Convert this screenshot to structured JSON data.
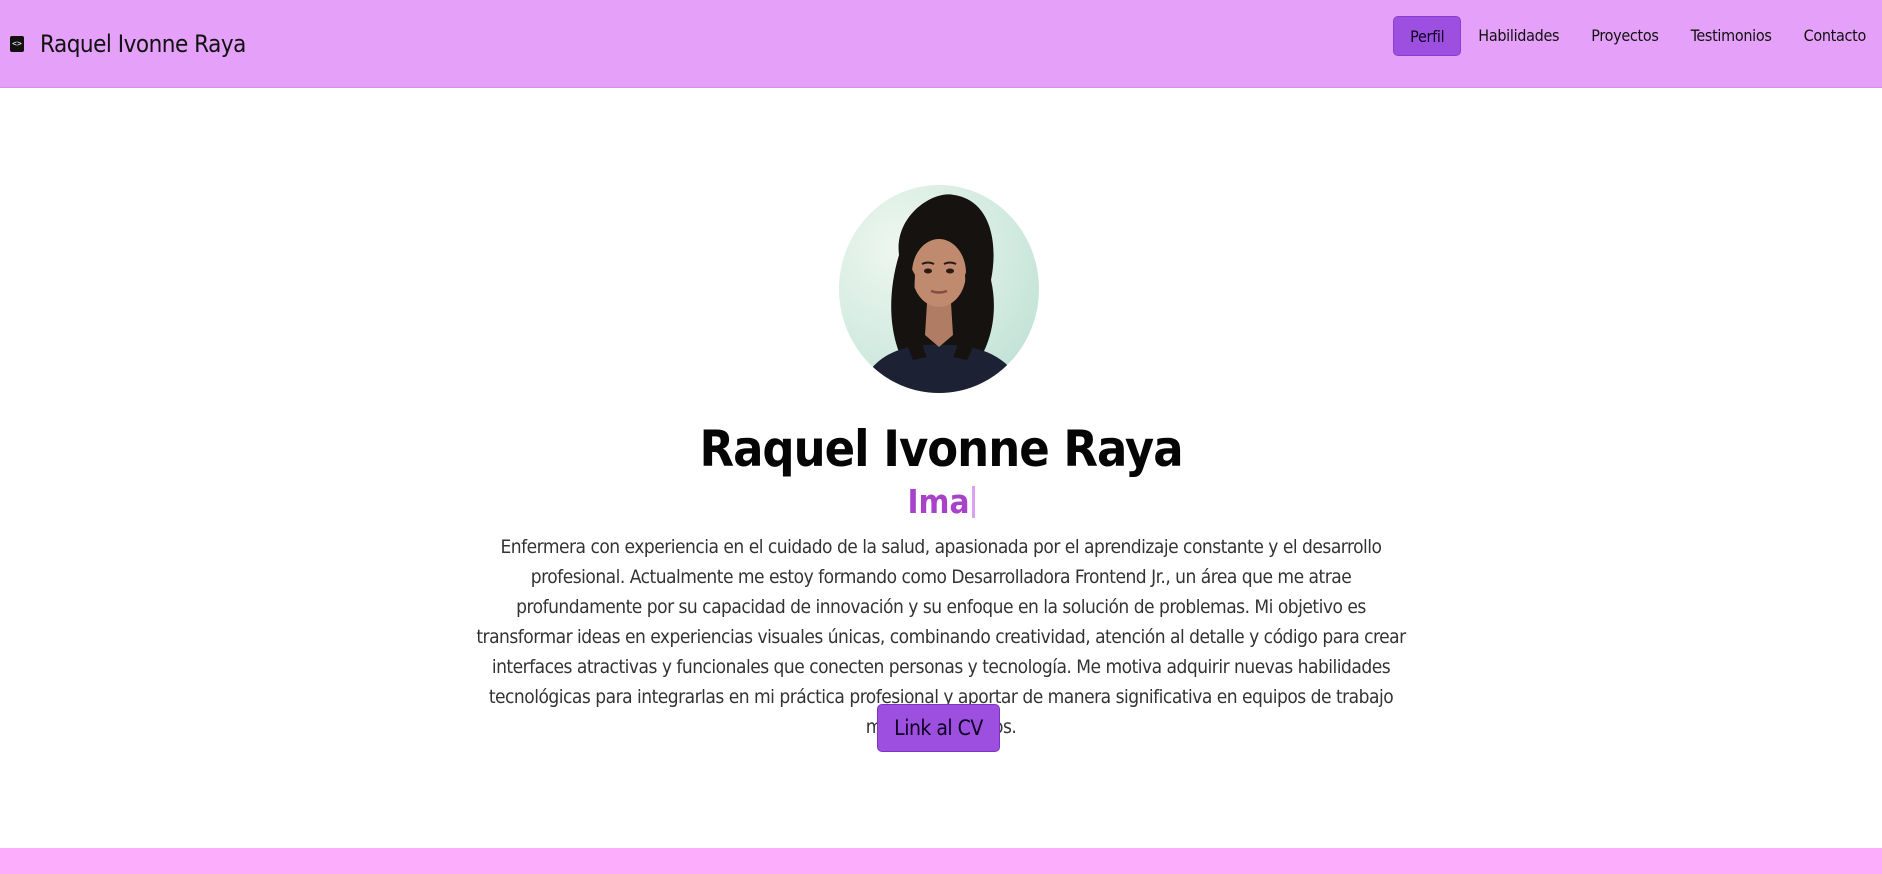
{
  "header": {
    "brand_icon": "<>",
    "brand_name": "Raquel Ivonne Raya",
    "nav": [
      {
        "label": "Perfil",
        "active": true
      },
      {
        "label": "Habilidades",
        "active": false
      },
      {
        "label": "Proyectos",
        "active": false
      },
      {
        "label": "Testimonios",
        "active": false
      },
      {
        "label": "Contacto",
        "active": false
      }
    ]
  },
  "profile": {
    "name": "Raquel Ivonne Raya",
    "typed_text": "Ima",
    "about": "Enfermera con experiencia en el cuidado de la salud, apasionada por el aprendizaje constante y el desarrollo profesional. Actualmente me estoy formando como Desarrolladora Frontend Jr., un área que me atrae profundamente por su capacidad de innovación y su enfoque en la solución de problemas. Mi objetivo es transformar ideas en experiencias visuales únicas, combinando creatividad, atención al detalle y código para crear interfaces atractivas y funcionales que conecten personas y tecnología. Me motiva adquirir nuevas habilidades tecnológicas para integrarlas en mi práctica profesional y aportar de manera significativa en equipos de trabajo multidisciplinarios.",
    "cv_button": "Link al CV"
  },
  "colors": {
    "navbar": "#e5a1f9",
    "accent": "#9d4fdf",
    "typed": "#a742c9",
    "next_section": "#fcaefc"
  }
}
